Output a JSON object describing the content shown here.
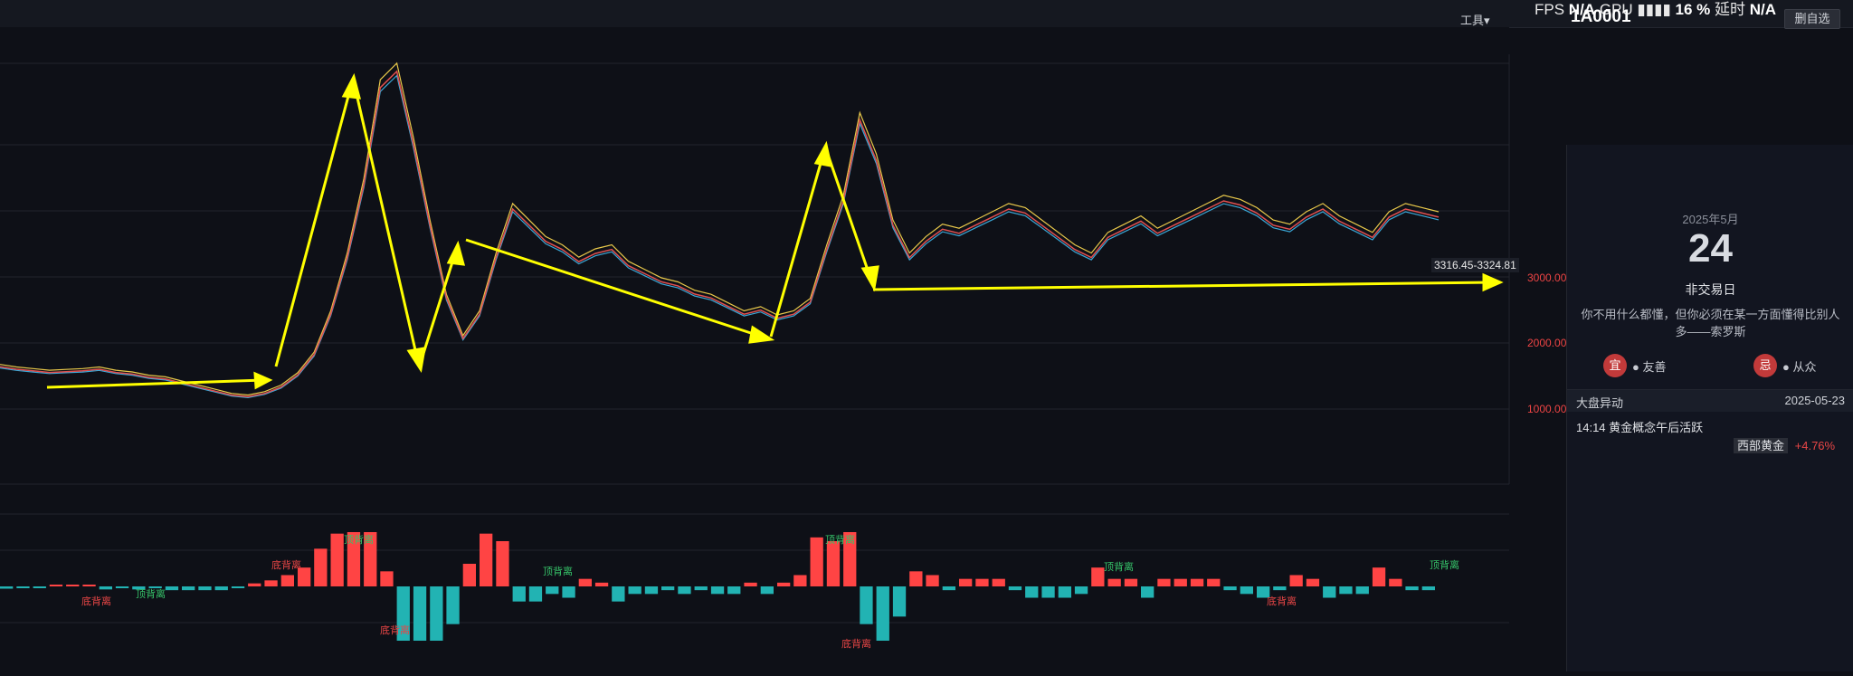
{
  "header": {
    "fps_label": "FPS",
    "fps_value": "N/A",
    "gpu_label": "GPU",
    "latency_value": "16 %",
    "latency_label": "延时",
    "latency_na": "N/A",
    "symbol": "1A0001",
    "tools_label": "工具",
    "delete_watch_label": "删自选"
  },
  "chart": {
    "price_tip": "3316.45-3324.81",
    "y_axis_labels": [
      "3000.00",
      "2000.00",
      "1000.00"
    ],
    "accent_color": "#ffff00",
    "up_color": "#ff4444",
    "down_color": "#22b3b3"
  },
  "chart_data": {
    "type": "line",
    "series": [
      {
        "values": [
          1450,
          1420,
          1400,
          1380,
          1390,
          1400,
          1420,
          1380,
          1360,
          1320,
          1300,
          1250,
          1200,
          1150,
          1100,
          1080,
          1120,
          1200,
          1350,
          1600,
          2100,
          2800,
          3700,
          4900,
          5100,
          4200,
          3200,
          2300,
          1800,
          2100,
          2800,
          3400,
          3200,
          3000,
          2900,
          2750,
          2850,
          2900,
          2700,
          2600,
          2500,
          2450,
          2350,
          2300,
          2200,
          2100,
          2150,
          2050,
          2100,
          2250,
          2900,
          3500,
          4500,
          4000,
          3200,
          2800,
          3000,
          3150,
          3100,
          3200,
          3300,
          3400,
          3350,
          3200,
          3050,
          2900,
          2800,
          3050,
          3150,
          3250,
          3100,
          3200,
          3300,
          3400,
          3500,
          3450,
          3350,
          3200,
          3150,
          3300,
          3400,
          3250,
          3150,
          3050,
          3300,
          3400,
          3350,
          3300
        ]
      }
    ],
    "indicator_labels": [
      "底背离",
      "顶背离"
    ],
    "ylim": [
      0,
      5200
    ]
  },
  "sidebar": {
    "month": "2025年5月",
    "day": "24",
    "status": "非交易日",
    "quote": "你不用什么都懂，但你必须在某一方面懂得比别人多——索罗斯",
    "tags": [
      {
        "icon_text": "宜",
        "label": "● 友善"
      },
      {
        "icon_text": "忌",
        "label": "● 从众"
      }
    ],
    "section_title": "大盘异动",
    "section_date": "2025-05-23",
    "news_time": "14:14",
    "news_text": "黄金概念午后活跃",
    "stocks": [
      {
        "name": "西部黄金",
        "change": "+4.76%"
      }
    ]
  }
}
